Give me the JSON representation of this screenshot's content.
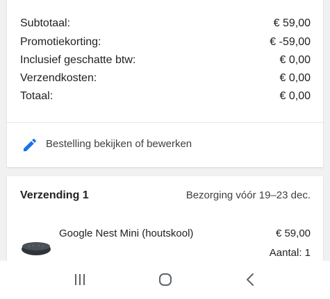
{
  "summary": {
    "rows": [
      {
        "label": "Subtotaal:",
        "value": "€ 59,00"
      },
      {
        "label": "Promotiekorting:",
        "value": "€ -59,00"
      },
      {
        "label": "Inclusief geschatte btw:",
        "value": "€ 0,00"
      },
      {
        "label": "Verzendkosten:",
        "value": "€ 0,00"
      },
      {
        "label": "Totaal:",
        "value": "€ 0,00"
      }
    ],
    "edit_label": "Bestelling bekijken of bewerken",
    "edit_icon": "pencil-icon",
    "accent_color": "#1a73e8"
  },
  "shipment": {
    "title": "Verzending 1",
    "delivery": "Bezorging vóór 19–23 dec.",
    "product": {
      "name": "Google Nest Mini (houtskool)",
      "price": "€ 59,00",
      "quantity": "Aantal: 1",
      "image_icon": "nest-mini-speaker-icon"
    }
  },
  "nav": {
    "buttons": [
      "recents-icon",
      "home-icon",
      "back-icon"
    ]
  }
}
